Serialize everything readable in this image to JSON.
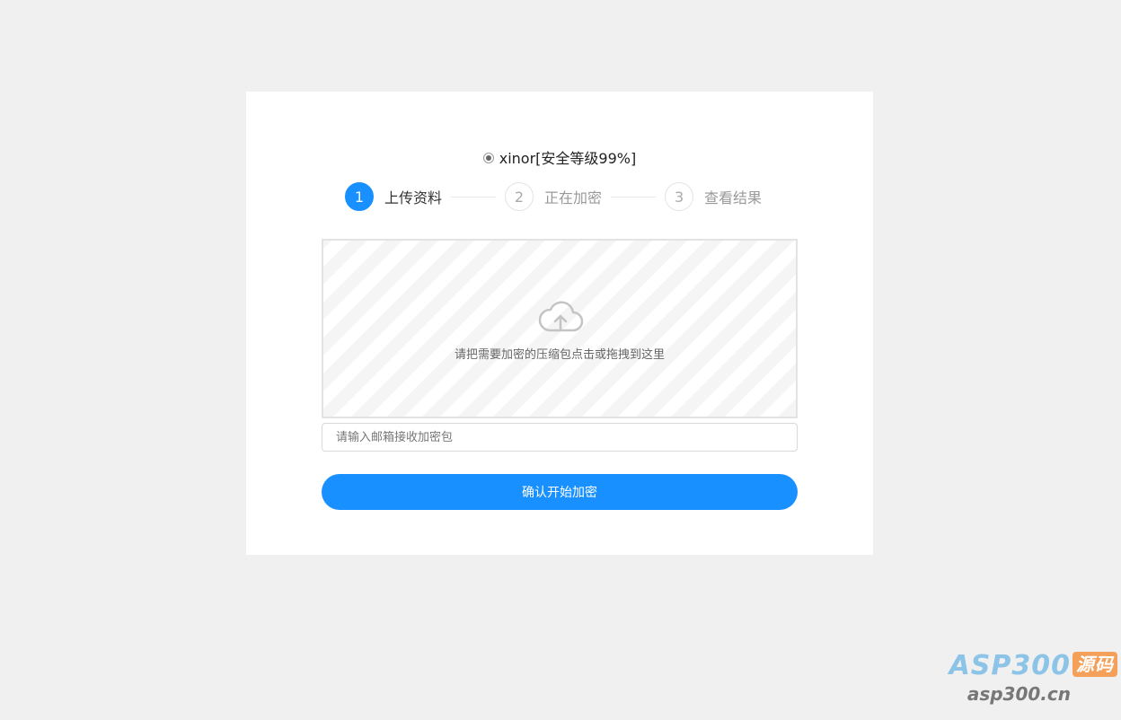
{
  "option": {
    "label": "xinor[安全等级99%]",
    "selected": true
  },
  "steps": [
    {
      "number": "1",
      "label": "上传资料",
      "active": true
    },
    {
      "number": "2",
      "label": "正在加密",
      "active": false
    },
    {
      "number": "3",
      "label": "查看结果",
      "active": false
    }
  ],
  "dropzone": {
    "icon": "cloud-upload-icon",
    "text": "请把需要加密的压缩包点击或拖拽到这里"
  },
  "email": {
    "value": "",
    "placeholder": "请输入邮箱接收加密包"
  },
  "submit": {
    "label": "确认开始加密"
  },
  "watermark": {
    "brand": "ASP300",
    "badge": "源码",
    "site": "asp300.cn"
  },
  "colors": {
    "primary": "#1890ff",
    "background": "#f0f0f0",
    "card": "#ffffff"
  }
}
